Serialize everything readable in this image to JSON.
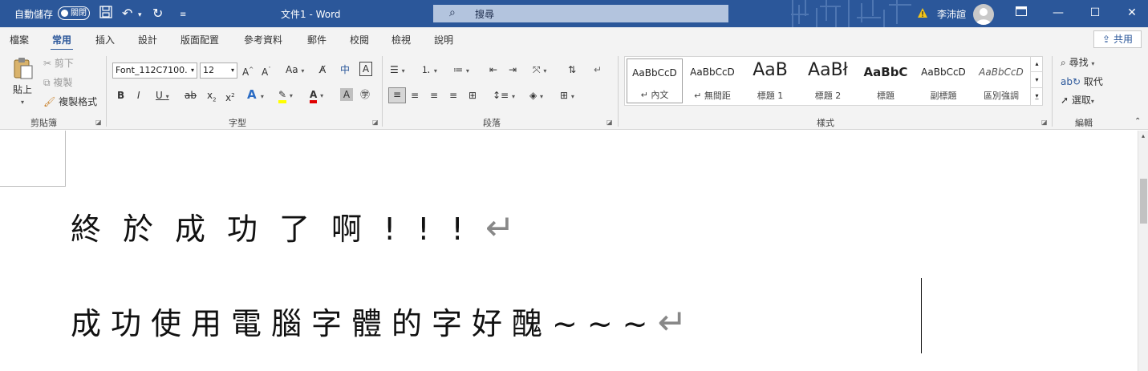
{
  "titlebar": {
    "autosave_label": "自動儲存",
    "autosave_state": "關閉",
    "doc_title": "文件1  -  Word",
    "search_placeholder": "搜尋",
    "user_name": "李沛諠",
    "save_icon": "save-icon",
    "undo_icon": "undo-icon",
    "redo_icon": "redo-icon"
  },
  "tabs": [
    "檔案",
    "常用",
    "插入",
    "設計",
    "版面配置",
    "參考資料",
    "郵件",
    "校閱",
    "檢視",
    "說明"
  ],
  "active_tab": "常用",
  "share_label": "共用",
  "clipboard": {
    "paste": "貼上",
    "cut": "剪下",
    "copy": "複製",
    "format_painter": "複製格式",
    "group": "剪貼簿"
  },
  "font": {
    "family": "Font_112C7100.",
    "size": "12",
    "group": "字型"
  },
  "paragraph": {
    "group": "段落"
  },
  "styles": {
    "group": "樣式",
    "items": [
      {
        "sample": "AaBbCcD",
        "name": "↵ 內文"
      },
      {
        "sample": "AaBbCcD",
        "name": "↵ 無間距"
      },
      {
        "sample": "AaB",
        "name": "標題 1"
      },
      {
        "sample": "AaBł",
        "name": "標題 2"
      },
      {
        "sample": "AaBbC",
        "name": "標題"
      },
      {
        "sample": "AaBbCcD",
        "name": "副標題"
      },
      {
        "sample": "AaBbCcD",
        "name": "區別強調"
      }
    ]
  },
  "editing": {
    "find": "尋找",
    "replace": "取代",
    "select": "選取",
    "group": "編輯"
  },
  "document": {
    "line1": "終於成功了啊!!!",
    "line2": "成功使用電腦字體的字好醜~~~",
    "para_mark": "↵"
  }
}
